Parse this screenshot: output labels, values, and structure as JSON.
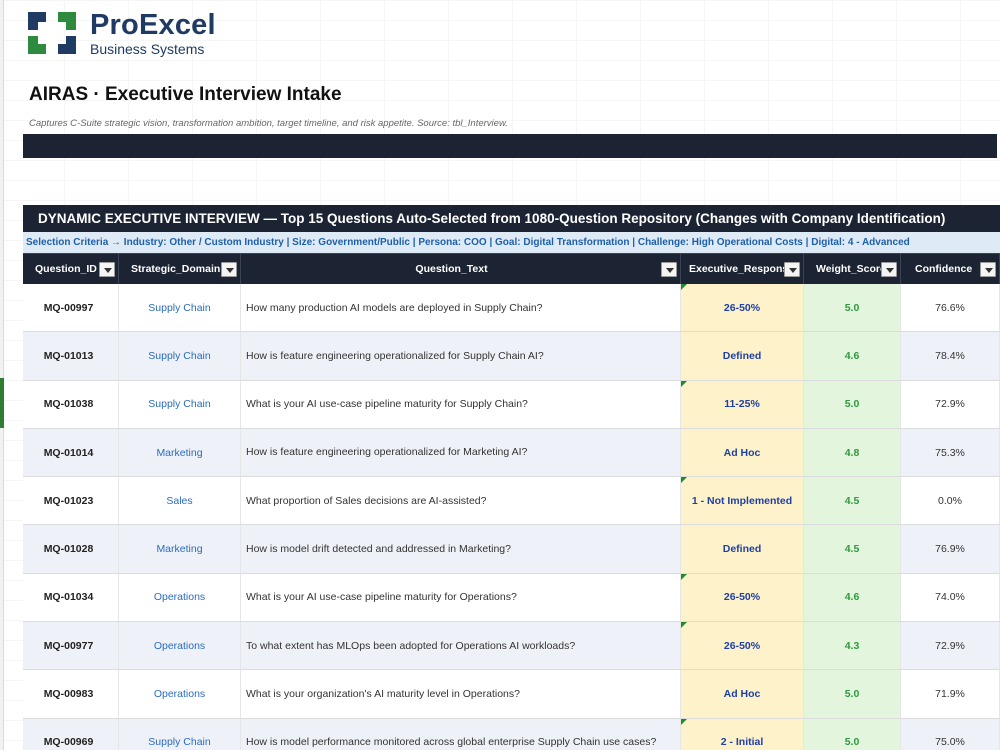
{
  "logo": {
    "name": "ProExcel",
    "subtitle": "Business Systems"
  },
  "page": {
    "title": "AIRAS · Executive Interview Intake",
    "description": "Captures C-Suite strategic vision, transformation ambition, target timeline, and risk appetite. Source: tbl_Interview."
  },
  "table": {
    "title": "DYNAMIC EXECUTIVE INTERVIEW — Top 15 Questions Auto-Selected from 1080-Question Repository (Changes with Company Identification)",
    "criteria": "Selection Criteria → Industry: Other / Custom Industry  |  Size: Government/Public  |  Persona: COO  |  Goal: Digital Transformation  |  Challenge: High Operational Costs  |  Digital: 4 - Advanced",
    "headers": [
      "Question_ID",
      "Strategic_Domain",
      "Question_Text",
      "Executive_Response",
      "Weight_Score",
      "Confidence"
    ],
    "rows": [
      {
        "id": "MQ-00997",
        "domain": "Supply Chain",
        "question": "How many production AI models are deployed in Supply Chain?",
        "response": "26-50%",
        "weight": "5.0",
        "confidence": "76.6%"
      },
      {
        "id": "MQ-01013",
        "domain": "Supply Chain",
        "question": "How is feature engineering operationalized for Supply Chain AI?",
        "response": "Defined",
        "weight": "4.6",
        "confidence": "78.4%"
      },
      {
        "id": "MQ-01038",
        "domain": "Supply Chain",
        "question": "What is your AI use-case pipeline maturity for Supply Chain?",
        "response": "11-25%",
        "weight": "5.0",
        "confidence": "72.9%"
      },
      {
        "id": "MQ-01014",
        "domain": "Marketing",
        "question": "How is feature engineering operationalized for Marketing AI?",
        "response": "Ad Hoc",
        "weight": "4.8",
        "confidence": "75.3%"
      },
      {
        "id": "MQ-01023",
        "domain": "Sales",
        "question": "What proportion of Sales decisions are AI-assisted?",
        "response": "1 - Not Implemented",
        "weight": "4.5",
        "confidence": "0.0%"
      },
      {
        "id": "MQ-01028",
        "domain": "Marketing",
        "question": "How is model drift detected and addressed in Marketing?",
        "response": "Defined",
        "weight": "4.5",
        "confidence": "76.9%"
      },
      {
        "id": "MQ-01034",
        "domain": "Operations",
        "question": "What is your AI use-case pipeline maturity for Operations?",
        "response": "26-50%",
        "weight": "4.6",
        "confidence": "74.0%"
      },
      {
        "id": "MQ-00977",
        "domain": "Operations",
        "question": "To what extent has MLOps been adopted for Operations AI workloads?",
        "response": "26-50%",
        "weight": "4.3",
        "confidence": "72.9%"
      },
      {
        "id": "MQ-00983",
        "domain": "Operations",
        "question": "What is your organization's AI maturity level in Operations?",
        "response": "Ad Hoc",
        "weight": "5.0",
        "confidence": "71.9%"
      },
      {
        "id": "MQ-00969",
        "domain": "Supply Chain",
        "question": "How is model performance monitored across global enterprise Supply Chain use cases?",
        "response": "2 - Initial",
        "weight": "5.0",
        "confidence": "75.0%"
      }
    ]
  },
  "colors": {
    "brand_navy": "#1f3b63",
    "logo_green": "#2e8b3e",
    "header_dark": "#1c2433",
    "response_fill": "#fdf2c9",
    "weight_fill": "#e3f5dd",
    "link_blue": "#2a6cc0"
  }
}
